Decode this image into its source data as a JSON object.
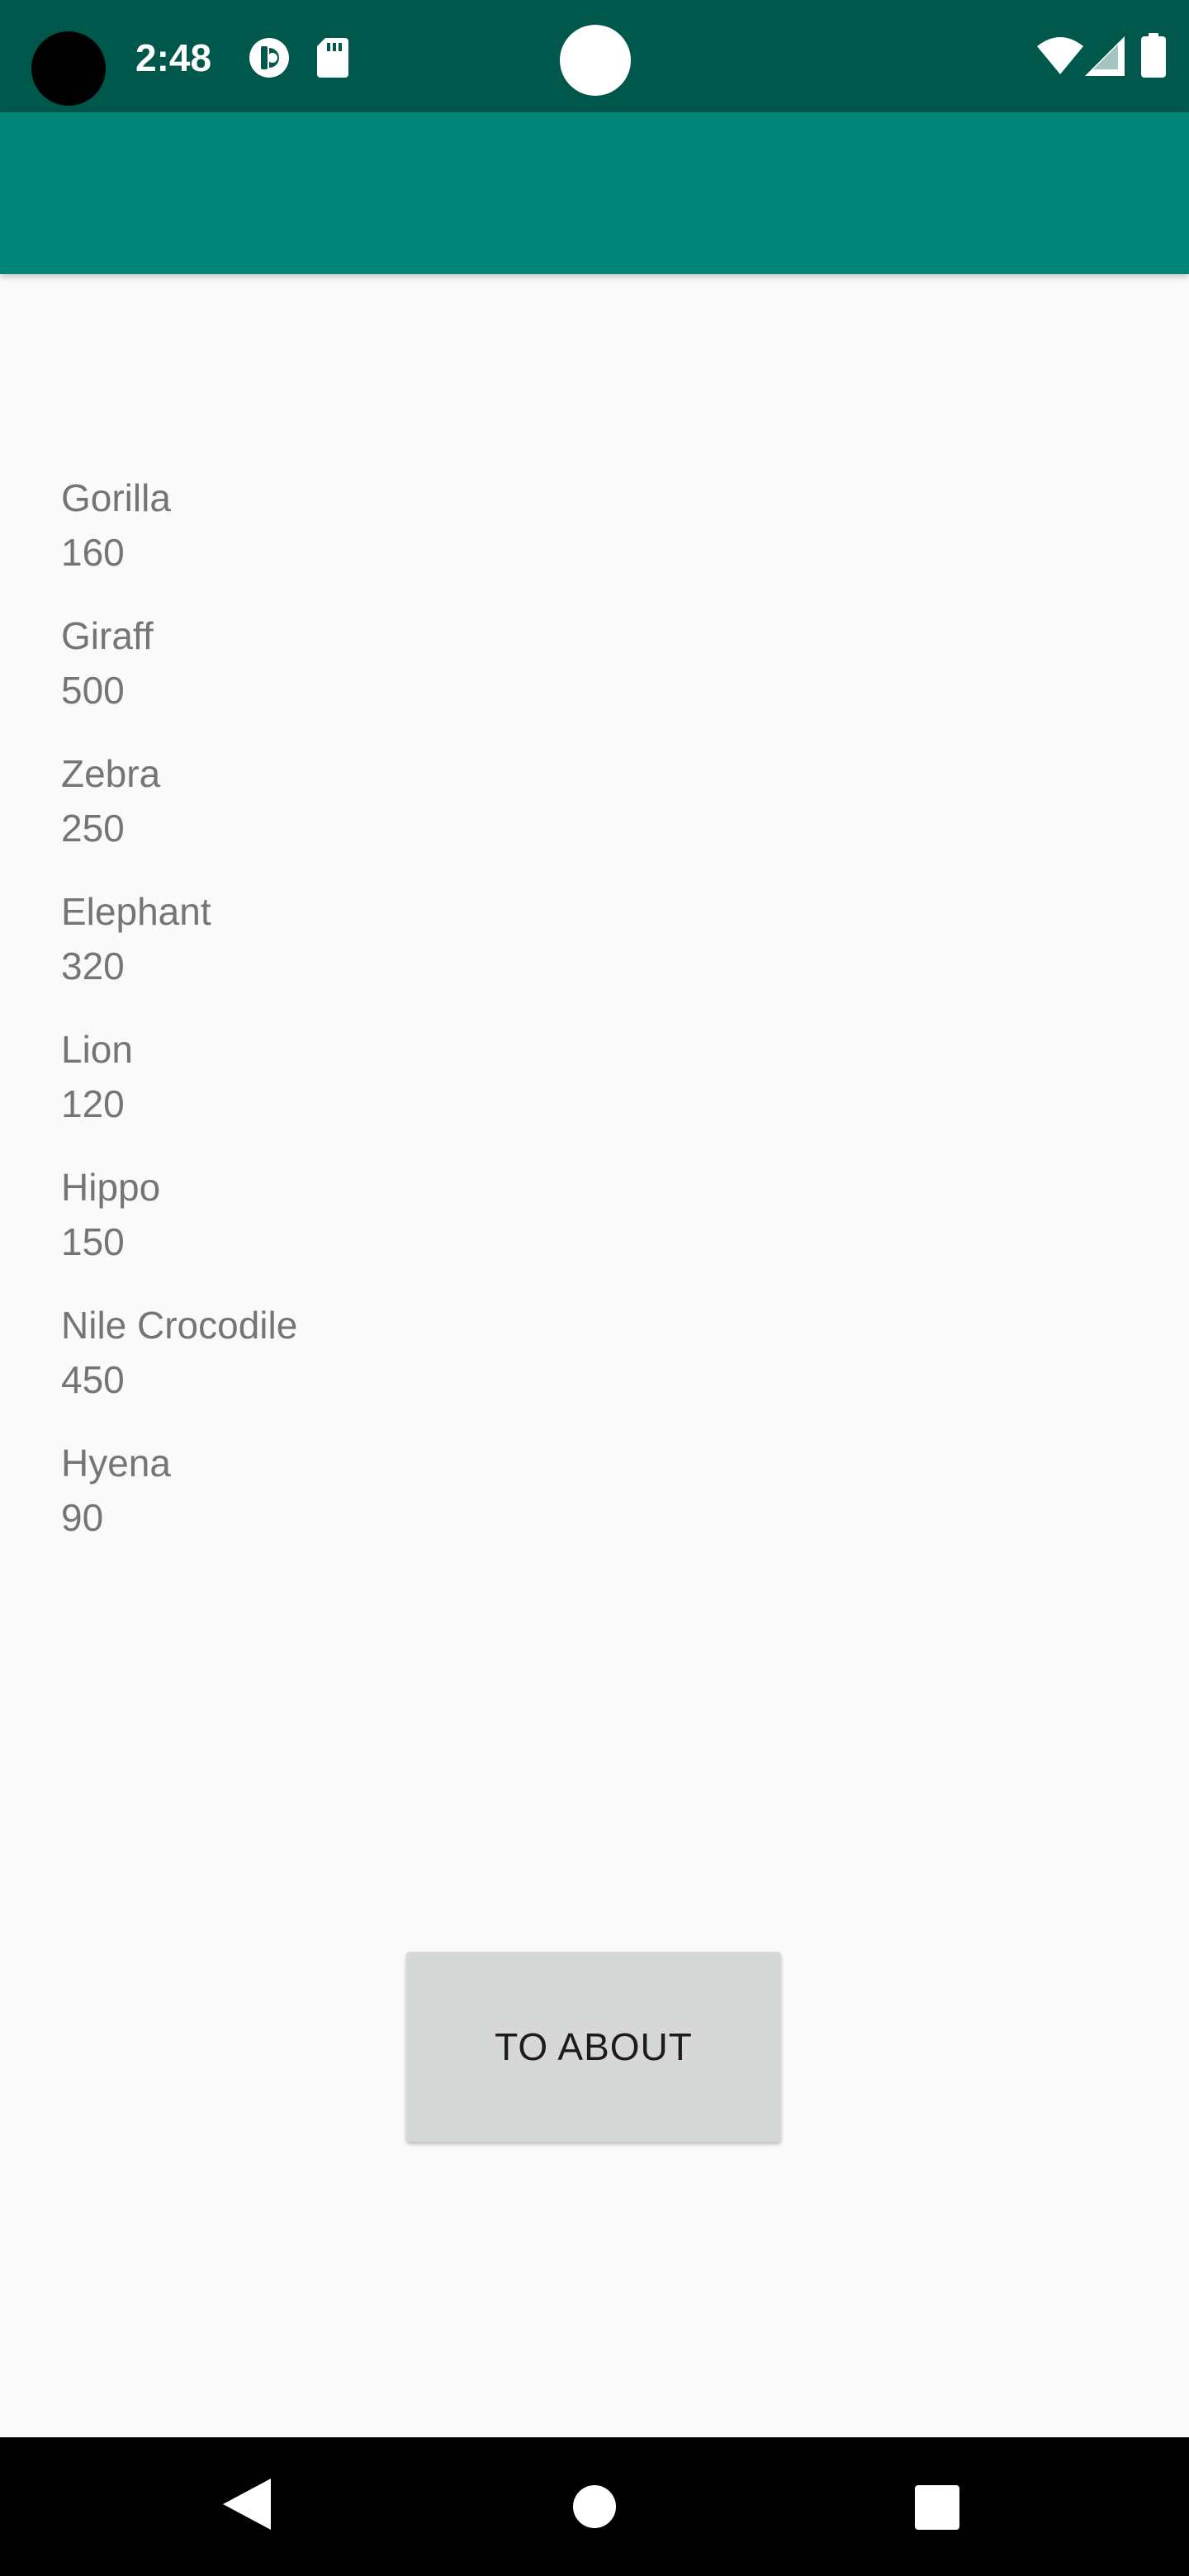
{
  "status_bar": {
    "time": "2:48",
    "background_color": "#00574b",
    "icons": [
      "camera-cutout",
      "sync-icon",
      "sd-card-icon",
      "notification-dot",
      "wifi-icon",
      "signal-icon",
      "battery-icon"
    ]
  },
  "app_bar": {
    "background_color": "#008577"
  },
  "animals": [
    {
      "name": "Gorilla",
      "value": "160"
    },
    {
      "name": "Giraff",
      "value": "500"
    },
    {
      "name": "Zebra",
      "value": "250"
    },
    {
      "name": "Elephant",
      "value": "320"
    },
    {
      "name": "Lion",
      "value": "120"
    },
    {
      "name": "Hippo",
      "value": "150"
    },
    {
      "name": "Nile Crocodile",
      "value": "450"
    },
    {
      "name": "Hyena",
      "value": "90"
    }
  ],
  "button": {
    "label": "TO ABOUT"
  },
  "nav_bar": {
    "icons": [
      "back-icon",
      "home-icon",
      "recents-icon"
    ]
  }
}
